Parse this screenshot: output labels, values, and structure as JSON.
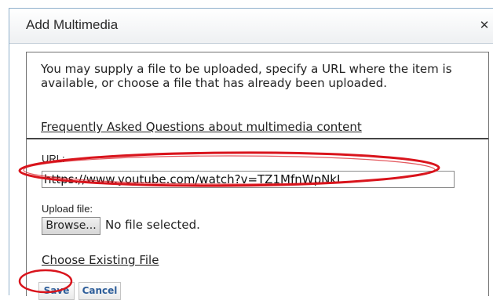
{
  "dialog": {
    "title": "Add Multimedia",
    "close_icon": "close-icon"
  },
  "info": {
    "description": "You may supply a file to be uploaded, specify a URL where the item is available, or choose a file that has already been uploaded.",
    "faq_link": "Frequently Asked Questions about multimedia content"
  },
  "form": {
    "url_label": "URL:",
    "url_value": "https://www.youtube.com/watch?v=TZ1MfnWpNkI",
    "upload_label": "Upload file:",
    "browse_label": "Browse...",
    "no_file_text": "No file selected.",
    "choose_existing": "Choose Existing File"
  },
  "buttons": {
    "save": "Save",
    "cancel": "Cancel"
  },
  "colors": {
    "annotation": "#d9141c",
    "button_text": "#2e5e9a",
    "border": "#8fb0cc"
  }
}
